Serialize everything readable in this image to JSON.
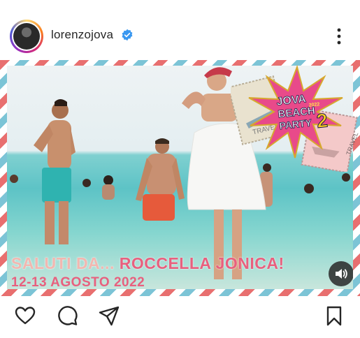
{
  "post": {
    "username": "lorenzojova",
    "verified": true,
    "caption_line1_prefix": "SALUTI DA... ",
    "caption_line1_place": "ROCCELLA JONICA!",
    "caption_line2": "12-13 AGOSTO 2022"
  },
  "logo": {
    "line1": "JOVA",
    "line2": "BEACH",
    "line3": "PARTY",
    "year": "2022",
    "number": "2",
    "stamp_text": "TRAVEL"
  },
  "icons": {
    "like": "heart-icon",
    "comment": "comment-icon",
    "share": "send-icon",
    "save": "bookmark-icon",
    "more": "more-icon",
    "sound": "speaker-icon"
  },
  "colors": {
    "accent_pink": "#e8607e",
    "verified_blue": "#3897f0",
    "border_red": "#e86f6f",
    "border_blue": "#7cc4d6"
  }
}
